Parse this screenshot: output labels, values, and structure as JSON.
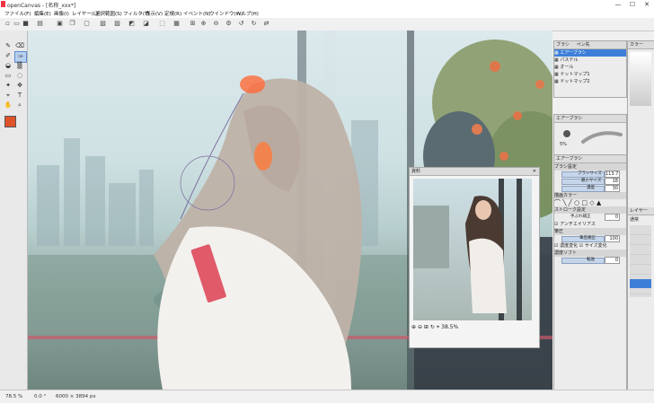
{
  "window": {
    "title": "openCanvas - [名称_xxx*]",
    "controls": [
      "—",
      "☐",
      "✕"
    ]
  },
  "menu": [
    "ファイル(F)",
    "編集(E)",
    "画像(I)",
    "レイヤー(L)",
    "選択範囲(S)",
    "フィルタ(T)",
    "表示(V)",
    "定規(R)",
    "イベント(N)",
    "ウインドウ(W)",
    "ヘルプ(H)"
  ],
  "brush_panel": {
    "tabs": [
      "ブラシ",
      "ペン先"
    ],
    "items": [
      "エアーブラシ",
      "パステル",
      "オール",
      "ドットマップ1",
      "ドットマップ2"
    ],
    "selected_index": 0
  },
  "preview": {
    "tab": "エアーブラシ",
    "size_label": "5%"
  },
  "brush_settings": {
    "header": "エアーブラシ",
    "section": "ブラシ設定",
    "rows": [
      {
        "label": "ブラシサイズ",
        "value": "113.7"
      },
      {
        "label": "最小サイズ",
        "value": "18"
      },
      {
        "label": "濃度",
        "value": "30"
      }
    ],
    "tip_section": "描画カラー",
    "stroke_section": "ストローク設定",
    "stroke_row": {
      "label": "手ぶれ補正",
      "value": "0"
    },
    "antialias": "アンチエイリアス",
    "pressure_section": "筆圧",
    "pressure_row": {
      "label": "筆圧補正",
      "value": "100"
    },
    "checks": [
      "濃度変化",
      "サイズ変化"
    ],
    "opacity_section": "濃度ソフト",
    "opacity_row": {
      "label": "転送",
      "value": "0"
    }
  },
  "reference": {
    "title": "資料",
    "zoom": "38.5%"
  },
  "right_strip": {
    "labels": [
      "カラー",
      "レイヤー",
      "通常"
    ]
  },
  "status": {
    "zoom": "78.5 %",
    "angle": "0.0 °",
    "size": "6000 × 3894 px"
  },
  "colors": {
    "accent": "#3d7fd8",
    "primary_color": "#e0532a",
    "secondary_color": "#f0e6dc"
  }
}
